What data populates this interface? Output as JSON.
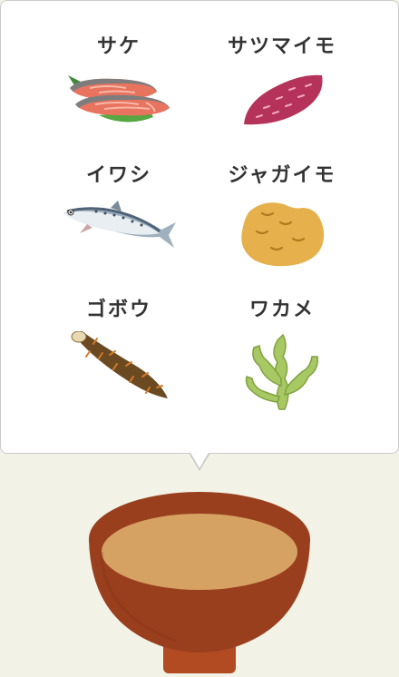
{
  "ingredients": [
    {
      "label": "サケ",
      "icon": "salmon-icon"
    },
    {
      "label": "サツマイモ",
      "icon": "sweet-potato-icon"
    },
    {
      "label": "イワシ",
      "icon": "sardine-icon"
    },
    {
      "label": "ジャガイモ",
      "icon": "potato-icon"
    },
    {
      "label": "ゴボウ",
      "icon": "burdock-icon"
    },
    {
      "label": "ワカメ",
      "icon": "wakame-icon"
    }
  ],
  "bowl": {
    "icon": "miso-soup-bowl-icon"
  },
  "colors": {
    "background": "#f2f2e6",
    "bowl": "#9a3f1e",
    "soup": "#d6a263",
    "salmon": "#e8735e",
    "sweet_potato": "#b5325a",
    "potato": "#e6b04c",
    "wakame": "#a8c864"
  }
}
